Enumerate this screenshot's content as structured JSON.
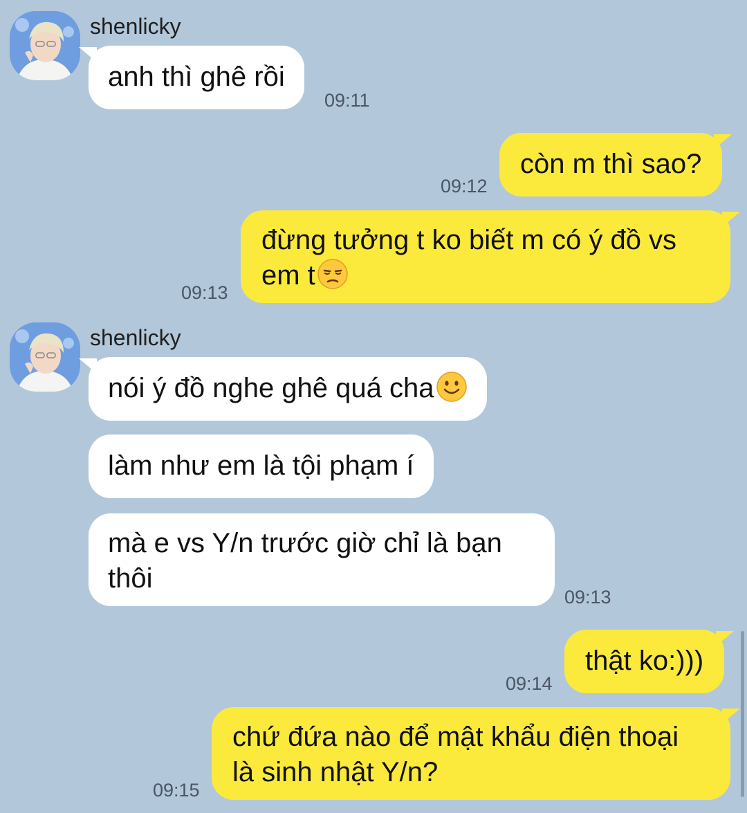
{
  "messages": [
    {
      "sender": "shenlicky",
      "text": "anh thì ghê rồi",
      "time": "09:11"
    },
    {
      "text": "còn m thì sao?",
      "time": "09:12"
    },
    {
      "line1": "đừng tưởng t ko biết m có ý đồ vs",
      "line2": "em t",
      "emoji": "unamused-face-icon",
      "time": "09:13"
    },
    {
      "sender": "shenlicky",
      "text": "nói ý đồ nghe ghê quá cha",
      "emoji": "slightly-smiling-face-icon"
    },
    {
      "text": "làm như em là tội phạm í"
    },
    {
      "line1": "mà e vs Y/n trước giờ chỉ là bạn",
      "line2": "thôi",
      "time": "09:13"
    },
    {
      "text": "thật ko:)))",
      "time": "09:14"
    },
    {
      "line1": "chứ đứa nào để mật khẩu điện thoại",
      "line2": "là sinh nhật Y/n?",
      "time": "09:15"
    }
  ],
  "colors": {
    "background": "#B2C7DA",
    "incoming_bubble": "#FFFFFF",
    "outgoing_bubble": "#FBEA3C",
    "timestamp": "#4a5563"
  }
}
